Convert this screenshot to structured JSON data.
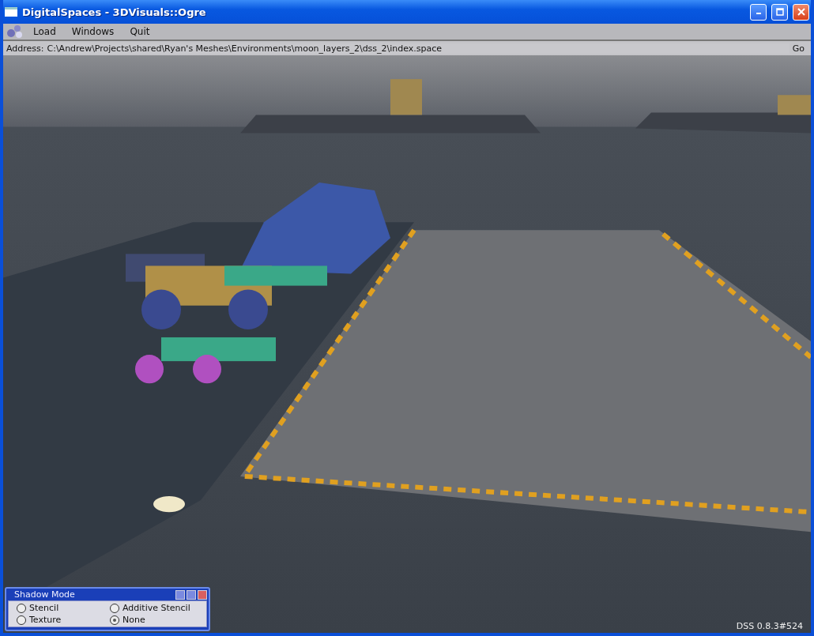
{
  "window": {
    "title": "DigitalSpaces - 3DVisuals::Ogre"
  },
  "menu": [
    "Load",
    "Windows",
    "Quit"
  ],
  "address": {
    "label": "Address:",
    "value": "C:\\Andrew\\Projects\\shared\\Ryan's Meshes\\Environments\\moon_layers_2\\dss_2\\index.space",
    "button": "Go"
  },
  "shadow_mode": {
    "title": "Shadow Mode",
    "options": [
      {
        "label": "Stencil",
        "selected": false
      },
      {
        "label": "Additive Stencil",
        "selected": false
      },
      {
        "label": "Texture",
        "selected": false
      },
      {
        "label": "None",
        "selected": true
      }
    ]
  },
  "status": "DSS 0.8.3#524"
}
